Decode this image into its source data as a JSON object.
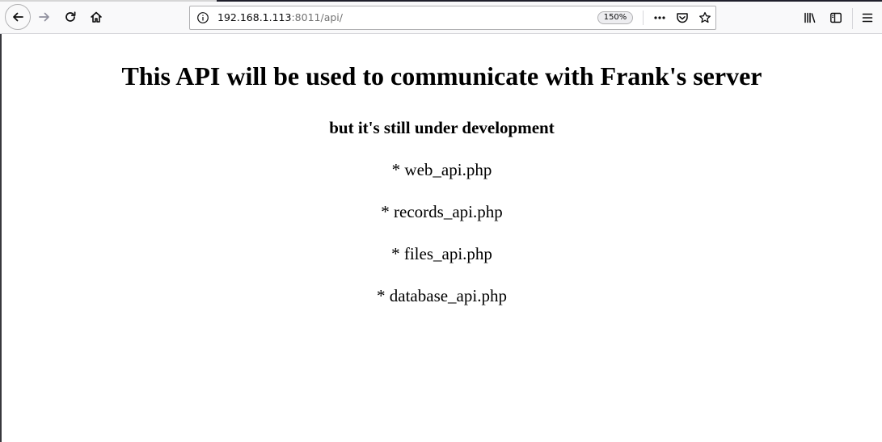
{
  "browser": {
    "url_host": "192.168.1.113",
    "url_rest": ":8011/api/",
    "zoom_level": "150%",
    "icons": {
      "back": "arrow-left-icon",
      "forward": "arrow-right-icon",
      "reload": "reload-icon",
      "home": "home-icon",
      "site_info": "info-icon",
      "page_actions": "more-horizontal-icon",
      "pocket": "pocket-icon",
      "bookmark": "star-icon",
      "library": "library-icon",
      "sidebar": "sidebar-icon",
      "menu": "hamburger-menu-icon"
    }
  },
  "page": {
    "heading": "This API will be used to communicate with Frank's server",
    "subheading": "but it's still under development",
    "api_items": [
      "* web_api.php",
      "* records_api.php",
      "* files_api.php",
      "* database_api.php"
    ]
  }
}
